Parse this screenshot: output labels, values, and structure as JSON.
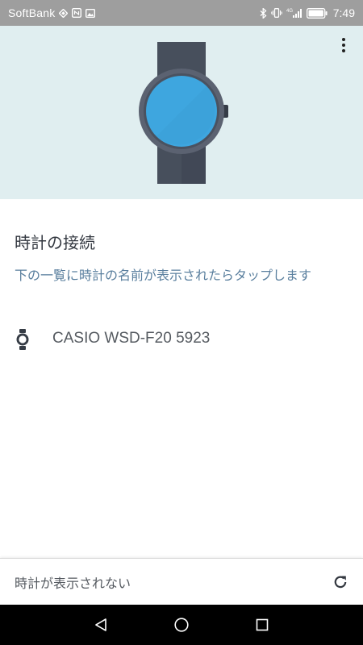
{
  "status_bar": {
    "carrier": "SoftBank",
    "network_type": "4G",
    "time": "7:49",
    "icons": [
      "data-sync-icon",
      "nfc-icon",
      "image-notification-icon",
      "bluetooth-icon",
      "vibrate-icon",
      "signal-icon",
      "battery-icon"
    ]
  },
  "hero": {
    "background": "#e0eef0",
    "watch_face_color": "#3ea6df",
    "watch_body_color": "#4a5260"
  },
  "content": {
    "title": "時計の接続",
    "instruction": "下の一覧に時計の名前が表示されたらタップします",
    "devices": [
      {
        "name": "CASIO WSD-F20 5923",
        "icon": "watch-icon"
      }
    ]
  },
  "bottom_bar": {
    "text": "時計が表示されない",
    "action_icon": "refresh-icon"
  },
  "nav_bar": {
    "buttons": [
      "back-icon",
      "home-icon",
      "recent-apps-icon"
    ]
  },
  "colors": {
    "accent_text": "#5a7f9e",
    "status_bar": "#9e9e9e",
    "nav_bar": "#000000"
  }
}
